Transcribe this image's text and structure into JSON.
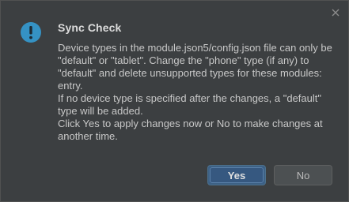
{
  "dialog": {
    "title": "Sync Check",
    "icon": "info-icon",
    "close_icon": "close-icon",
    "message": [
      "Device types in the module.json5/config.json file can only be \"default\" or \"tablet\". Change the \"phone\" type (if any) to \"default\" and delete unsupported types for these modules: entry.",
      "If no device type is specified after the changes, a \"default\" type will be added.",
      "Click Yes to apply changes now or No to make changes at another time."
    ],
    "buttons": {
      "yes_label": "Yes",
      "no_label": "No"
    },
    "colors": {
      "background": "#3c3f41",
      "icon_blue": "#3592c4",
      "primary_button": "#365880",
      "secondary_button": "#4c5052"
    }
  }
}
